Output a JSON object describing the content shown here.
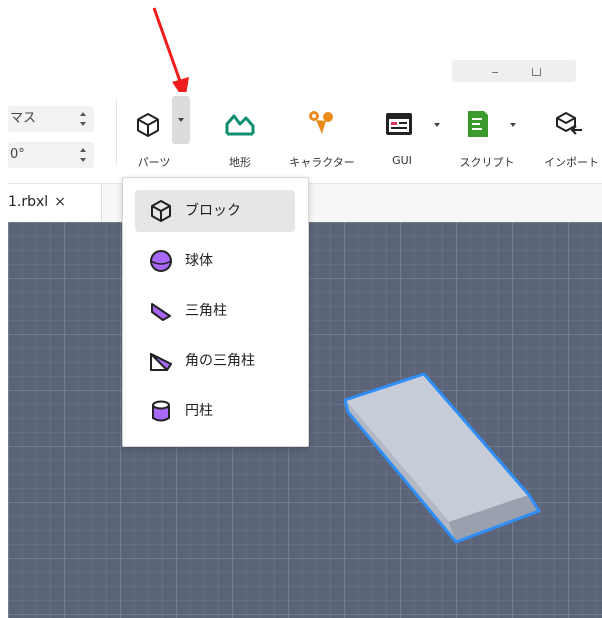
{
  "toolbar": {
    "fields": [
      {
        "text": "マス"
      },
      {
        "text": "0°"
      }
    ],
    "tools": [
      {
        "label": "パーツ",
        "icon": "cube-icon"
      },
      {
        "label": "地形",
        "icon": "terrain-icon"
      },
      {
        "label": "キャラクター",
        "icon": "character-icon"
      },
      {
        "label": "GUI",
        "icon": "gui-icon"
      },
      {
        "label": "スクリプト",
        "icon": "script-icon"
      },
      {
        "label": "インポート",
        "icon": "import-icon"
      }
    ]
  },
  "tabs": [
    {
      "label": "1.rbxl",
      "close": "×"
    }
  ],
  "parts_menu": {
    "items": [
      {
        "label": "ブロック",
        "icon": "block-icon",
        "selected": true
      },
      {
        "label": "球体",
        "icon": "sphere-icon"
      },
      {
        "label": "三角柱",
        "icon": "wedge-icon"
      },
      {
        "label": "角の三角柱",
        "icon": "corner-wedge-icon"
      },
      {
        "label": "円柱",
        "icon": "cylinder-icon"
      }
    ]
  },
  "colors": {
    "accent": "#2f8ff7",
    "annotation_arrow": "#ee1c1c",
    "viewport": "#5b6478",
    "sphere": "#a768f5"
  }
}
